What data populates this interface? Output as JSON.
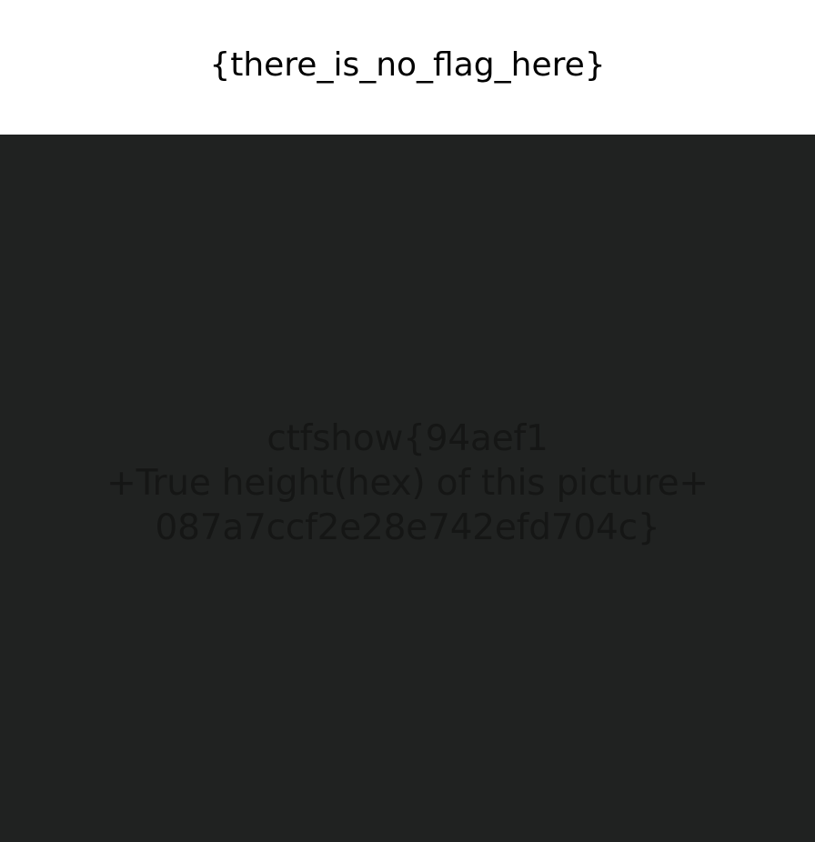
{
  "banner": {
    "text": "{there_is_no_flag_here}"
  },
  "hidden_message": {
    "line1": "ctfshow{94aef1",
    "line2": "+True height(hex) of this picture+",
    "line3": "087a7ccf2e28e742efd704c}"
  },
  "colors": {
    "banner_background": "#ffffff",
    "banner_text": "#000000",
    "dark_background": "#202221",
    "hidden_text": "#151615"
  }
}
